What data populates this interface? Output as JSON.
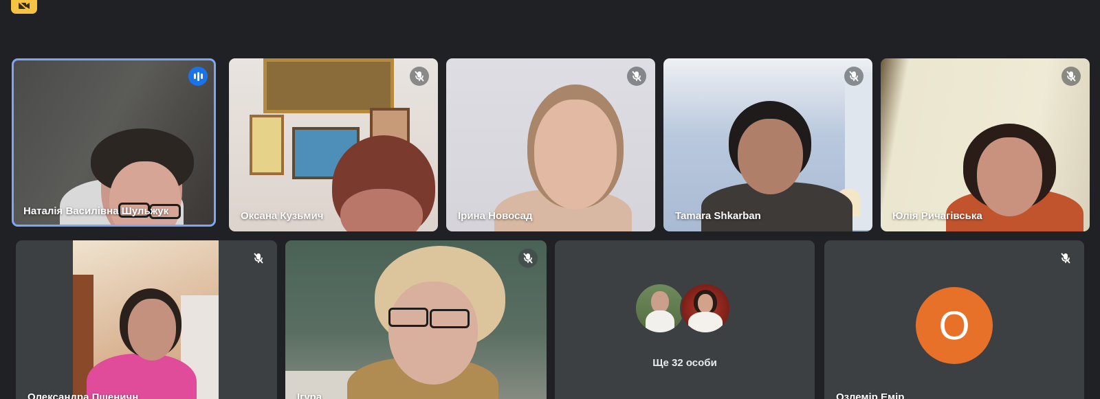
{
  "participants_row1": [
    {
      "name": "Наталія Василівна Шульжук",
      "state": "speaking"
    },
    {
      "name": "Оксана Кузьмич",
      "state": "muted"
    },
    {
      "name": "Ірина Новосад",
      "state": "muted"
    },
    {
      "name": "Tamara Shkarban",
      "state": "muted"
    },
    {
      "name": "Юлія Ричагівська",
      "state": "muted"
    }
  ],
  "participants_row2": [
    {
      "name": "Олександра Пшеничн",
      "state": "muted"
    },
    {
      "name": "Ігура",
      "state": "muted"
    }
  ],
  "more_tile": {
    "label": "Ще 32 особи"
  },
  "avatar_tile": {
    "name": "Озлемір Емір",
    "initial": "O",
    "avatar_color": "#e8712a",
    "state": "muted"
  },
  "colors": {
    "background": "#202124",
    "tile": "#3c4043",
    "active_border": "#8ab4f8",
    "speaking": "#1a73e8",
    "badge": "#f6c343"
  },
  "icons": {
    "muted": "mic-off-icon",
    "speaking": "speaking-indicator-icon",
    "badge": "camera-off-icon"
  }
}
